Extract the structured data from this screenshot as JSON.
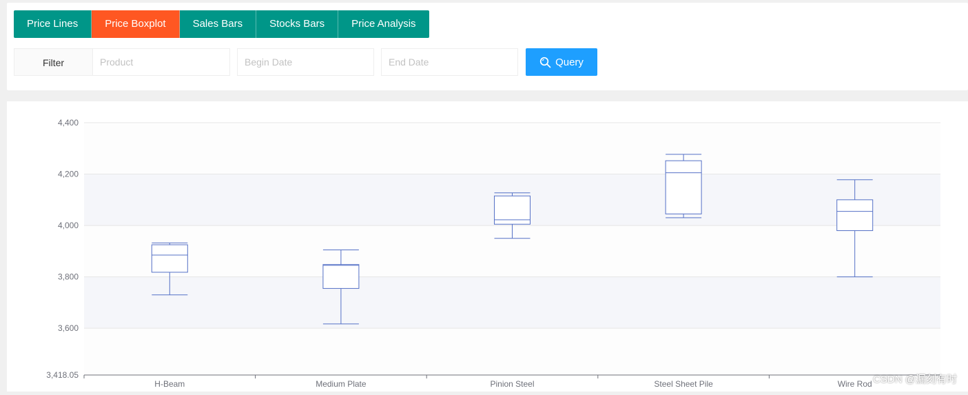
{
  "tabs": [
    {
      "label": "Price Lines",
      "active": false
    },
    {
      "label": "Price Boxplot",
      "active": true
    },
    {
      "label": "Sales Bars",
      "active": false
    },
    {
      "label": "Stocks Bars",
      "active": false
    },
    {
      "label": "Price Analysis",
      "active": false
    }
  ],
  "filter": {
    "label": "Filter",
    "product_placeholder": "Product",
    "begin_placeholder": "Begin Date",
    "end_placeholder": "End Date",
    "query_label": "Query",
    "query_icon": "search-icon"
  },
  "colors": {
    "tab_bg": "#009688",
    "tab_active_bg": "#ff5722",
    "query_bg": "#1e9fff",
    "box_stroke": "#5470c6",
    "band_fill": "#f5f6fa"
  },
  "chart_data": {
    "type": "boxplot",
    "categories": [
      "H-Beam",
      "Medium Plate",
      "Pinion Steel",
      "Steel Sheet Pile",
      "Wire Rod"
    ],
    "boxes": [
      {
        "min": 3730,
        "q1": 3818,
        "median": 3885,
        "q3": 3925,
        "max": 3932
      },
      {
        "min": 3617,
        "q1": 3755,
        "median": 3845,
        "q3": 3848,
        "max": 3905
      },
      {
        "min": 3950,
        "q1": 4005,
        "median": 4022,
        "q3": 4115,
        "max": 4127
      },
      {
        "min": 4030,
        "q1": 4045,
        "median": 4205,
        "q3": 4252,
        "max": 4277
      },
      {
        "min": 3800,
        "q1": 3980,
        "median": 4055,
        "q3": 4100,
        "max": 4178
      }
    ],
    "ylim": [
      3418.05,
      4400
    ],
    "yticks": [
      "4,400",
      "4,200",
      "4,000",
      "3,800",
      "3,600",
      "3,418.05"
    ],
    "ytick_values": [
      4400,
      4200,
      4000,
      3800,
      3600,
      3418.05
    ],
    "split_area": true,
    "legend": "none"
  },
  "watermark": "CSDN @漏刻有时"
}
